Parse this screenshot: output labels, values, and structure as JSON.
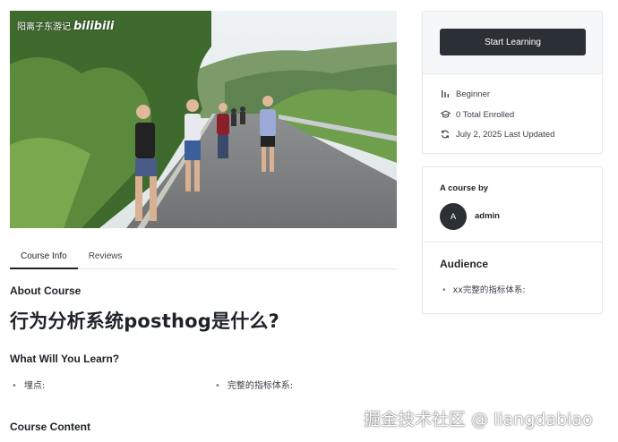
{
  "video": {
    "watermark_text": "阳离子东游记",
    "watermark_brand": "bilibili"
  },
  "tabs": [
    {
      "label": "Course Info",
      "active": true
    },
    {
      "label": "Reviews",
      "active": false
    }
  ],
  "course": {
    "about_heading": "About Course",
    "title": "行为分析系统posthog是什么?",
    "learn_heading": "What Will You Learn?",
    "learn_items": [
      "埋点:",
      "完整的指标体系:"
    ],
    "content_heading": "Course Content"
  },
  "enroll_card": {
    "button_label": "Start Learning",
    "level": "Beginner",
    "enrolled": "0 Total Enrolled",
    "updated": "July 2, 2025 Last Updated",
    "icons": [
      "level-icon",
      "graduation-cap-icon",
      "refresh-icon"
    ]
  },
  "author_card": {
    "course_by": "A course by",
    "avatar_initial": "A",
    "author_name": "admin",
    "audience_heading": "Audience",
    "audience_items": [
      "xx完整的指标体系:"
    ]
  },
  "watermark": "掘金技术社区 @ liangdabiao",
  "colors": {
    "primary_button": "#2b2f36",
    "border": "#e6e8eb",
    "text": "#1f2328"
  }
}
